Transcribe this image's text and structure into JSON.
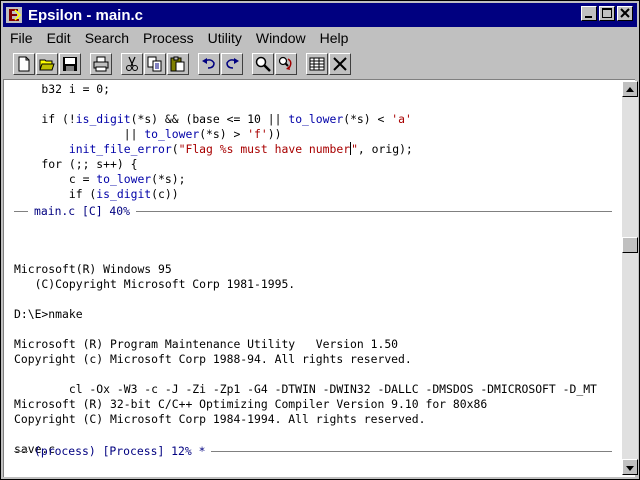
{
  "window": {
    "title": "Epsilon - main.c"
  },
  "menu": [
    "File",
    "Edit",
    "Search",
    "Process",
    "Utility",
    "Window",
    "Help"
  ],
  "toolbar": {
    "icons": [
      "new-file-icon",
      "open-folder-icon",
      "save-disk-icon",
      "print-icon",
      "cut-scissors-icon",
      "copy-icon",
      "paste-icon",
      "undo-icon",
      "redo-icon",
      "find-icon",
      "replace-icon",
      "buffer-list-icon",
      "close-x-icon"
    ]
  },
  "code_pane": {
    "lines": [
      {
        "parts": [
          {
            "t": "    b32 i = 0;"
          }
        ]
      },
      {
        "parts": [
          {
            "t": ""
          }
        ]
      },
      {
        "parts": [
          {
            "t": "    if (!"
          },
          {
            "t": "is_digit",
            "c": "fn"
          },
          {
            "t": "(*s) && (base <= 10 || "
          },
          {
            "t": "to_lower",
            "c": "fn"
          },
          {
            "t": "(*s) < "
          },
          {
            "t": "'a'",
            "c": "str"
          }
        ]
      },
      {
        "parts": [
          {
            "t": "                || "
          },
          {
            "t": "to_lower",
            "c": "fn"
          },
          {
            "t": "(*s) > "
          },
          {
            "t": "'f'",
            "c": "str"
          },
          {
            "t": "))"
          }
        ]
      },
      {
        "parts": [
          {
            "t": "        "
          },
          {
            "t": "init_file_error",
            "c": "fn"
          },
          {
            "t": "("
          },
          {
            "t": "\"Flag %s must have number",
            "c": "str"
          },
          {
            "t": "\"",
            "c": "str",
            "cursor": true
          },
          {
            "t": ", orig);"
          }
        ]
      },
      {
        "parts": [
          {
            "t": "    for (;; s++) {"
          }
        ]
      },
      {
        "parts": [
          {
            "t": "        c = "
          },
          {
            "t": "to_lower",
            "c": "fn"
          },
          {
            "t": "(*s);"
          }
        ]
      },
      {
        "parts": [
          {
            "t": "        if ("
          },
          {
            "t": "is_digit",
            "c": "fn"
          },
          {
            "t": "(c))"
          }
        ]
      }
    ],
    "modeline": "main.c [C] 40%"
  },
  "process_pane": {
    "lines": [
      "",
      "",
      "Microsoft(R) Windows 95",
      "   (C)Copyright Microsoft Corp 1981-1995.",
      "",
      "D:\\E>nmake",
      "",
      "Microsoft (R) Program Maintenance Utility   Version 1.50",
      "Copyright (c) Microsoft Corp 1988-94. All rights reserved.",
      "",
      "        cl -Ox -W3 -c -J -Zi -Zp1 -G4 -DTWIN -DWIN32 -DALLC -DMSDOS -DMICROSOFT -D_MT",
      "Microsoft (R) 32-bit C/C++ Optimizing Compiler Version 9.10 for 80x86",
      "Copyright (C) Microsoft Corp 1984-1994. All rights reserved.",
      "",
      "save.c"
    ],
    "modeline": "(process) [Process] 12% *"
  },
  "colors": {
    "titlebar": "#000080",
    "function": "#0000a8",
    "string": "#a80000"
  }
}
